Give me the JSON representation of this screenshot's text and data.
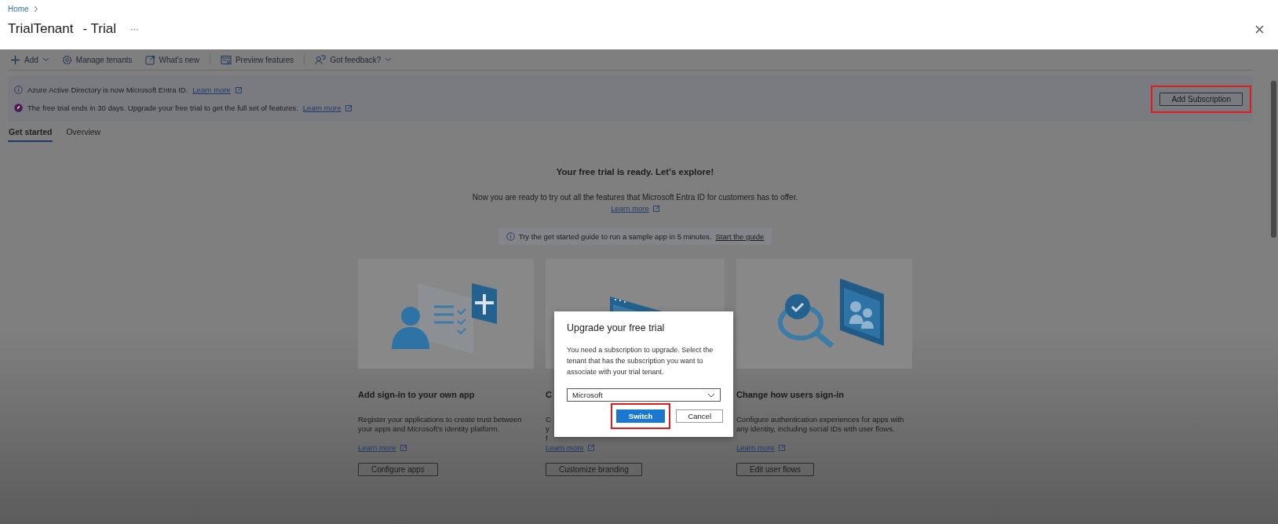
{
  "breadcrumb": {
    "items": [
      "Home"
    ]
  },
  "page": {
    "title": "TrialTenant",
    "subtitle": "- Trial",
    "more": "···"
  },
  "toolbar": [
    {
      "kind": "add",
      "label": "Add",
      "dropdown": true
    },
    {
      "kind": "gear",
      "label": "Manage tenants",
      "dropdown": false
    },
    {
      "kind": "new",
      "label": "What's new",
      "dropdown": false
    },
    {
      "kind": "preview",
      "label": "Preview features",
      "dropdown": false
    },
    {
      "kind": "feedback",
      "label": "Got feedback?",
      "dropdown": true
    }
  ],
  "notices": [
    {
      "kind": "info",
      "text": "Azure Active Directory is now Microsoft Entra ID.",
      "link": "Learn more"
    },
    {
      "kind": "trial",
      "text": "The free trial ends in 30 days. Upgrade your free trial to get the full set of features.",
      "link": "Learn more"
    }
  ],
  "add_subscription": {
    "label": "Add Subscription",
    "highlighted": true
  },
  "tabs": [
    {
      "label": "Get started",
      "selected": true
    },
    {
      "label": "Overview",
      "selected": false
    }
  ],
  "hero": {
    "title": "Your free trial is ready. Let's explore!",
    "text": "Now you are ready to try out all the features that Microsoft Entra ID for customers has to offer.",
    "link": "Learn more"
  },
  "guide": {
    "text": "Try the get started guide to run a sample app in 5 minutes.",
    "link": "Start the guide"
  },
  "cards": [
    {
      "kind": "user-list",
      "title": "Add sign-in to your own app",
      "lines": [
        "Register your applications to create trust between",
        "your apps and Microsoft's identity platform."
      ],
      "link": "Learn more",
      "button": "Configure apps"
    },
    {
      "kind": "browser",
      "title": "C",
      "lines": [
        "C",
        "y",
        "f"
      ],
      "link": "Learn more",
      "button": "Customize branding"
    },
    {
      "kind": "magnifier",
      "title": "Change how users sign-in",
      "lines": [
        "Configure authentication experiences for apps with",
        "any identity, including social IDs with user flows."
      ],
      "link": "Learn more",
      "button": "Edit user flows"
    }
  ],
  "dialog": {
    "title": "Upgrade your free trial",
    "text": "You need a subscription to upgrade. Select the tenant that has the subscription you want to associate with your trial tenant.",
    "select": {
      "value": "Microsoft"
    },
    "buttons": [
      {
        "kind": "primary",
        "label": "Switch",
        "highlighted": true
      },
      {
        "kind": "secondary",
        "label": "Cancel",
        "highlighted": false
      }
    ]
  }
}
